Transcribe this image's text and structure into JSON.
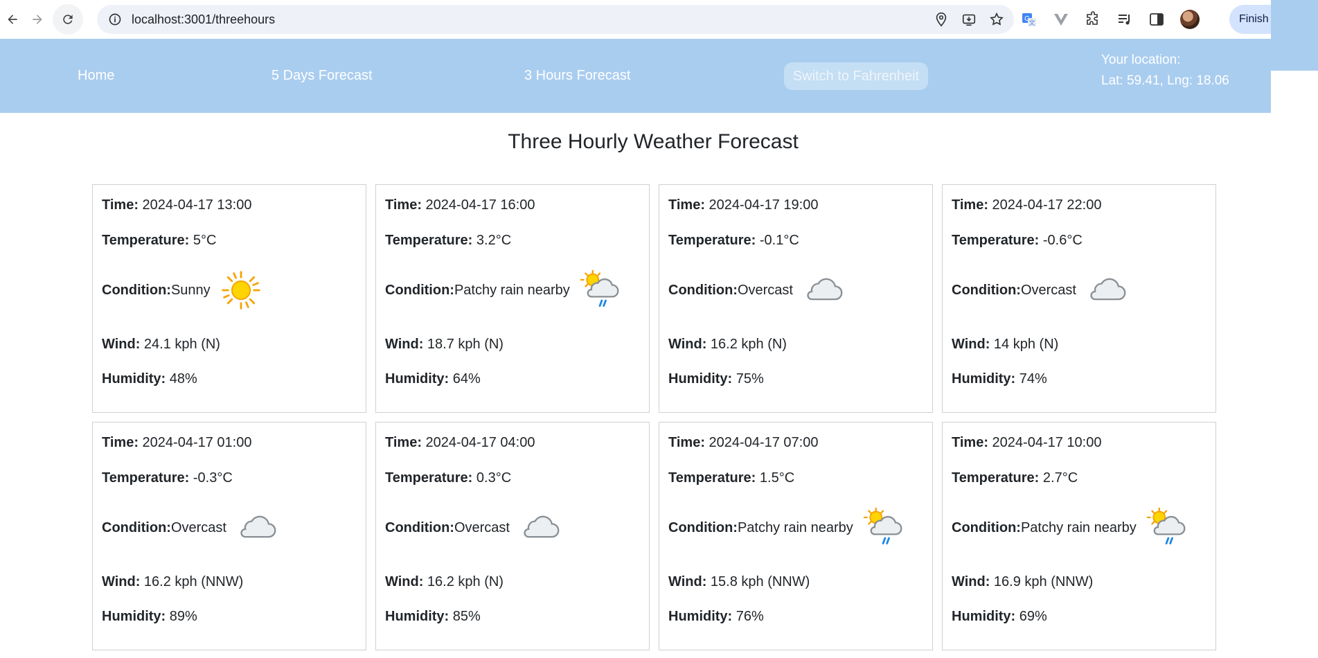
{
  "browser": {
    "url": "localhost:3001/threehours",
    "finish_label": "Finish u"
  },
  "nav": {
    "home": "Home",
    "five_days": "5 Days Forecast",
    "three_hours": "3 Hours Forecast",
    "toggle_unit": "Switch to Fahrenheit",
    "location_label": "Your location:",
    "location_coords": "Lat: 59.41, Lng: 18.06"
  },
  "page": {
    "title": "Three Hourly Weather Forecast"
  },
  "labels": {
    "time": "Time:",
    "temperature": "Temperature:",
    "condition": "Condition:",
    "wind": "Wind:",
    "humidity": "Humidity:"
  },
  "forecasts": [
    {
      "time": "2024-04-17 13:00",
      "temperature": "5°C",
      "condition": "Sunny",
      "icon": "sun-icon",
      "wind": "24.1 kph (N)",
      "humidity": "48%"
    },
    {
      "time": "2024-04-17 16:00",
      "temperature": "3.2°C",
      "condition": "Patchy rain nearby",
      "icon": "sun-cloud-rain-icon",
      "wind": "18.7 kph (N)",
      "humidity": "64%"
    },
    {
      "time": "2024-04-17 19:00",
      "temperature": "-0.1°C",
      "condition": "Overcast",
      "icon": "cloud-icon",
      "wind": "16.2 kph (N)",
      "humidity": "75%"
    },
    {
      "time": "2024-04-17 22:00",
      "temperature": "-0.6°C",
      "condition": "Overcast",
      "icon": "cloud-icon",
      "wind": "14 kph (N)",
      "humidity": "74%"
    },
    {
      "time": "2024-04-17 01:00",
      "temperature": "-0.3°C",
      "condition": "Overcast",
      "icon": "cloud-icon",
      "wind": "16.2 kph (NNW)",
      "humidity": "89%"
    },
    {
      "time": "2024-04-17 04:00",
      "temperature": "0.3°C",
      "condition": "Overcast",
      "icon": "cloud-icon",
      "wind": "16.2 kph (N)",
      "humidity": "85%"
    },
    {
      "time": "2024-04-17 07:00",
      "temperature": "1.5°C",
      "condition": "Patchy rain nearby",
      "icon": "sun-cloud-rain-icon",
      "wind": "15.8 kph (NNW)",
      "humidity": "76%"
    },
    {
      "time": "2024-04-17 10:00",
      "temperature": "2.7°C",
      "condition": "Patchy rain nearby",
      "icon": "sun-cloud-rain-icon",
      "wind": "16.9 kph (NNW)",
      "humidity": "69%"
    }
  ]
}
